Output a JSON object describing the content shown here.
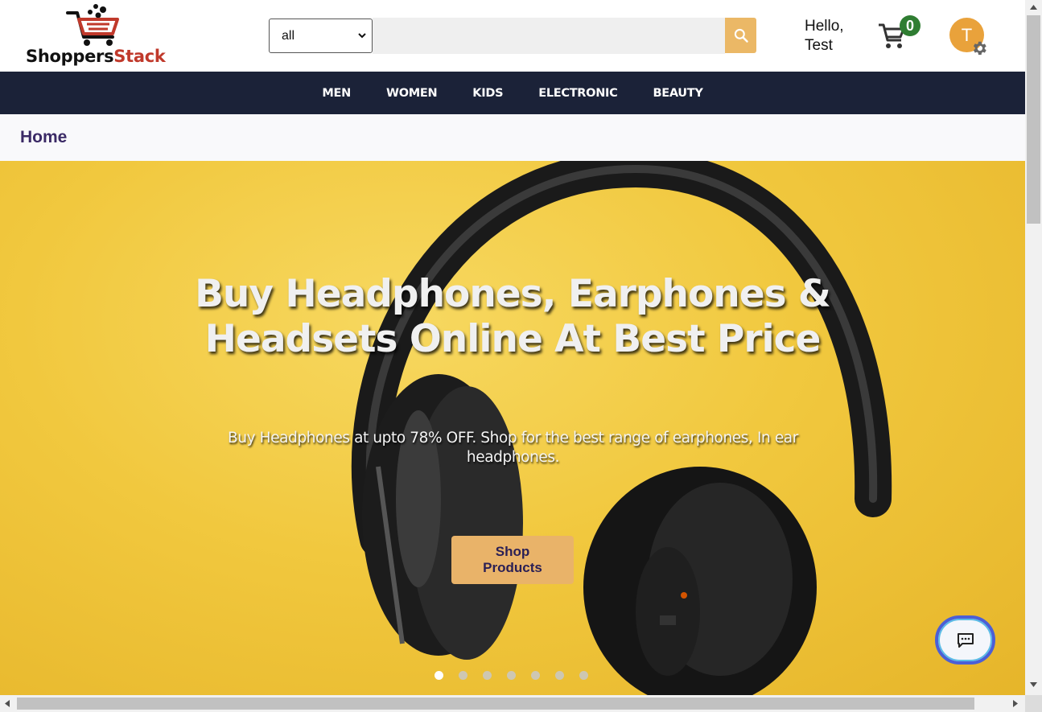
{
  "header": {
    "logo": {
      "text_main": "Shoppers",
      "text_accent": "Stack"
    },
    "category_select": {
      "value": "all"
    },
    "search": {
      "placeholder": "",
      "button_icon": "search-icon"
    },
    "greeting": {
      "line1": "Hello,",
      "line2": "Test"
    },
    "cart": {
      "icon": "cart-icon",
      "count": "0"
    },
    "avatar": {
      "initial": "T",
      "settings_icon": "gear-icon"
    }
  },
  "nav": {
    "items": [
      {
        "label": "MEN"
      },
      {
        "label": "WOMEN"
      },
      {
        "label": "KIDS"
      },
      {
        "label": "ELECTRONIC"
      },
      {
        "label": "BEAUTY"
      }
    ]
  },
  "breadcrumb": {
    "label": "Home"
  },
  "hero": {
    "title": "Buy Headphones, Earphones & Headsets Online At Best Price",
    "subtitle": "Buy Headphones at upto 78% OFF. Shop for the best range of earphones, In ear headphones.",
    "button_label_line1": "Shop",
    "button_label_line2": "Products",
    "slides_total": 7,
    "active_slide": 1
  },
  "chat": {
    "icon": "chat-icon"
  },
  "colors": {
    "nav_bg": "#1b2238",
    "accent": "#ebb866",
    "badge": "#2f7d32",
    "avatar": "#e9a23b",
    "breadcrumb_text": "#3b2a66",
    "hero_bg": "#f1c83e"
  }
}
